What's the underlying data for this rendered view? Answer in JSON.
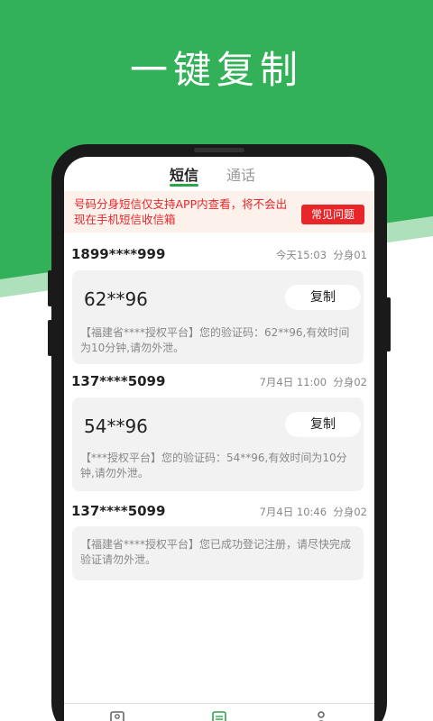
{
  "headline": "一键复制",
  "tabs": [
    {
      "label": "短信",
      "active": true
    },
    {
      "label": "通话",
      "active": false
    }
  ],
  "notice": {
    "text": "号码分身短信仅支持APP内查看，将不会出现在手机短信收信箱",
    "button_label": "常见问题"
  },
  "messages": [
    {
      "phone": "1899****999",
      "time": "今天15:03",
      "line": "分身01",
      "code": "62**96",
      "copy_label": "复制",
      "body": "【福建省****授权平台】您的验证码：62**96,有效时间为10分钟,请勿外泄。"
    },
    {
      "phone": "137****5099",
      "time": "7月4日 11:00",
      "line": "分身02",
      "code": "54**96",
      "copy_label": "复制",
      "body": "【***授权平台】您的验证码：54**96,有效时间为10分钟,请勿外泄。"
    },
    {
      "phone": "137****5099",
      "time": "7月4日 10:46",
      "line": "分身02",
      "body": "【福建省****授权平台】您已成功登记注册，请尽快完成验证请勿外泄。"
    }
  ],
  "colors": {
    "brand_green": "#33b158",
    "accent_red": "#e8262a",
    "card_bg": "#f2f2f2"
  },
  "nav_icons": [
    "contacts-icon",
    "messages-icon",
    "profile-icon"
  ]
}
